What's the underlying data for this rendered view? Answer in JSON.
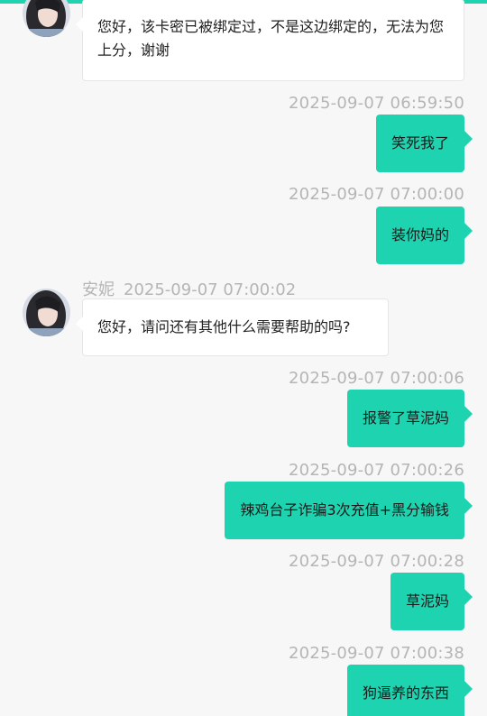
{
  "theme": {
    "accent": "#1ed4b0",
    "incoming_bg": "#ffffff",
    "background": "#f7f7f7",
    "timestamp_color": "#b5b5b5"
  },
  "messages": [
    {
      "direction": "in",
      "text": "您好，该卡密已被绑定过，不是这边绑定的，无法为您上分，谢谢"
    },
    {
      "direction": "out",
      "time": "2025-09-07 06:59:50",
      "text": "笑死我了"
    },
    {
      "direction": "out",
      "time": "2025-09-07 07:00:00",
      "text": "装你妈的"
    },
    {
      "direction": "in",
      "sender": "安妮",
      "time": "2025-09-07 07:00:02",
      "text": "您好，请问还有其他什么需要帮助的吗?"
    },
    {
      "direction": "out",
      "time": "2025-09-07 07:00:06",
      "text": "报警了草泥妈"
    },
    {
      "direction": "out",
      "time": "2025-09-07 07:00:26",
      "text": "辣鸡台子诈骗3次充值+黑分输钱"
    },
    {
      "direction": "out",
      "time": "2025-09-07 07:00:28",
      "text": "草泥妈"
    },
    {
      "direction": "out",
      "time": "2025-09-07 07:00:38",
      "text": "狗逼养的东西"
    }
  ],
  "icons": {
    "agent_avatar": "agent-avatar-icon"
  }
}
